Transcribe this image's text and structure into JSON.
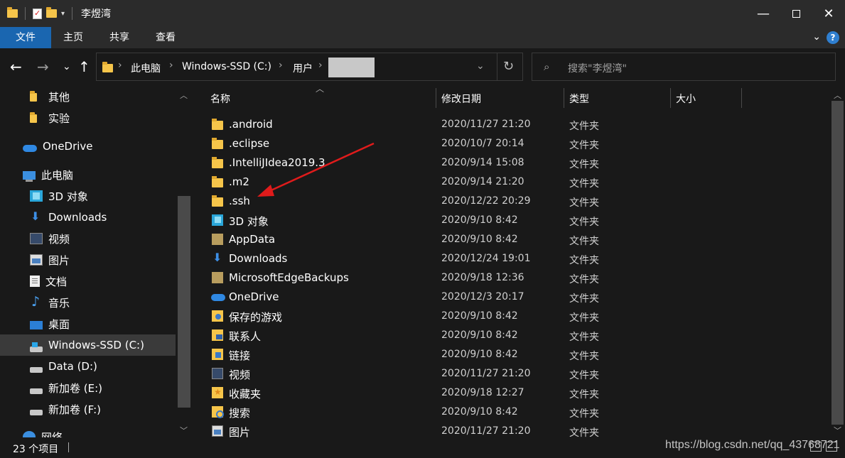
{
  "window": {
    "title": "李煜湾",
    "minimize": "—",
    "close": "✕"
  },
  "ribbon": {
    "tabs": [
      "文件",
      "主页",
      "共享",
      "查看"
    ],
    "expand": "⌄",
    "help": "?"
  },
  "nav": {
    "back": "←",
    "forward": "→",
    "recent": "⌄",
    "up": "↑",
    "breadcrumb": [
      "此电脑",
      "Windows-SSD (C:)",
      "用户"
    ],
    "crumb_sep": "›",
    "refresh": "↻",
    "dropdown": "⌄"
  },
  "search": {
    "placeholder": "搜索\"李煜湾\"",
    "icon": "⌕"
  },
  "sidebar": {
    "items": [
      {
        "label": "其他",
        "icon": "folder-icon"
      },
      {
        "label": "实验",
        "icon": "folder-icon"
      },
      {
        "label": "OneDrive",
        "icon": "cloud-icon"
      },
      {
        "label": "此电脑",
        "icon": "computer-icon"
      },
      {
        "label": "3D 对象",
        "icon": "cube-icon"
      },
      {
        "label": "Downloads",
        "icon": "download-icon"
      },
      {
        "label": "视频",
        "icon": "video-icon"
      },
      {
        "label": "图片",
        "icon": "picture-icon"
      },
      {
        "label": "文档",
        "icon": "document-icon"
      },
      {
        "label": "音乐",
        "icon": "music-icon"
      },
      {
        "label": "桌面",
        "icon": "desktop-icon"
      },
      {
        "label": "Windows-SSD (C:)",
        "icon": "system-drive-icon",
        "selected": true
      },
      {
        "label": "Data (D:)",
        "icon": "drive-icon"
      },
      {
        "label": "新加卷 (E:)",
        "icon": "drive-icon"
      },
      {
        "label": "新加卷 (F:)",
        "icon": "drive-icon"
      },
      {
        "label": "网络",
        "icon": "network-icon"
      }
    ]
  },
  "columns": {
    "name": "名称",
    "modified": "修改日期",
    "type": "类型",
    "size": "大小"
  },
  "files": [
    {
      "name": ".android",
      "date": "2020/11/27 21:20",
      "type": "文件夹",
      "icon": "folder-icon"
    },
    {
      "name": ".eclipse",
      "date": "2020/10/7 20:14",
      "type": "文件夹",
      "icon": "folder-icon"
    },
    {
      "name": ".IntelliJIdea2019.3",
      "date": "2020/9/14 15:08",
      "type": "文件夹",
      "icon": "folder-icon"
    },
    {
      "name": ".m2",
      "date": "2020/9/14 21:20",
      "type": "文件夹",
      "icon": "folder-icon"
    },
    {
      "name": ".ssh",
      "date": "2020/12/22 20:29",
      "type": "文件夹",
      "icon": "folder-icon"
    },
    {
      "name": "3D 对象",
      "date": "2020/9/10 8:42",
      "type": "文件夹",
      "icon": "cube-icon"
    },
    {
      "name": "AppData",
      "date": "2020/9/10 8:42",
      "type": "文件夹",
      "icon": "hidden-folder-icon"
    },
    {
      "name": "Downloads",
      "date": "2020/12/24 19:01",
      "type": "文件夹",
      "icon": "download-icon"
    },
    {
      "name": "MicrosoftEdgeBackups",
      "date": "2020/9/18 12:36",
      "type": "文件夹",
      "icon": "hidden-folder-icon"
    },
    {
      "name": "OneDrive",
      "date": "2020/12/3 20:17",
      "type": "文件夹",
      "icon": "cloud-icon"
    },
    {
      "name": "保存的游戏",
      "date": "2020/9/10 8:42",
      "type": "文件夹",
      "icon": "saved-games-icon"
    },
    {
      "name": "联系人",
      "date": "2020/9/10 8:42",
      "type": "文件夹",
      "icon": "contacts-icon"
    },
    {
      "name": "链接",
      "date": "2020/9/10 8:42",
      "type": "文件夹",
      "icon": "links-icon"
    },
    {
      "name": "视频",
      "date": "2020/11/27 21:20",
      "type": "文件夹",
      "icon": "video-icon"
    },
    {
      "name": "收藏夹",
      "date": "2020/9/18 12:27",
      "type": "文件夹",
      "icon": "favorites-icon"
    },
    {
      "name": "搜索",
      "date": "2020/9/10 8:42",
      "type": "文件夹",
      "icon": "searches-icon"
    },
    {
      "name": "图片",
      "date": "2020/11/27 21:20",
      "type": "文件夹",
      "icon": "picture-icon"
    }
  ],
  "status": {
    "count": "23 个项目",
    "watermark": "https://blog.csdn.net/qq_43768721"
  },
  "colors": {
    "background": "#191919",
    "titlebar": "#2b2b2b",
    "active_tab": "#1a66b0",
    "selected_nav": "#3a3a3a",
    "folder": "#f6c54a",
    "annotation_arrow": "#e01b1b"
  }
}
